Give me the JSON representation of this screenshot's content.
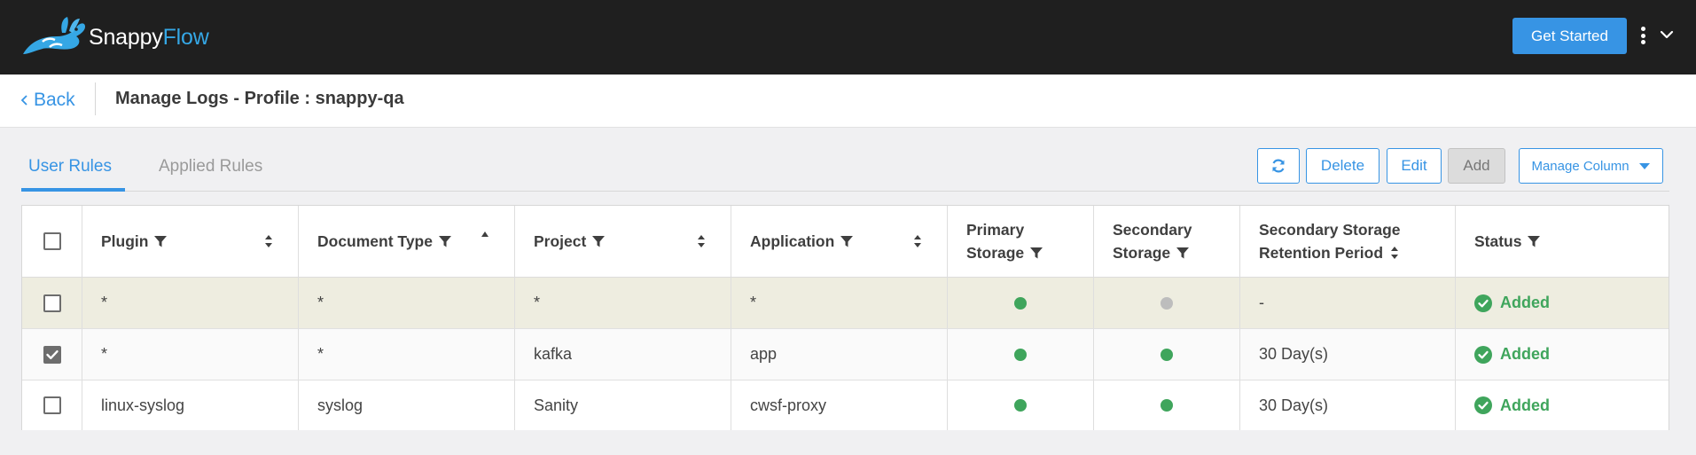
{
  "app": {
    "logo_text_1": "Snappy",
    "logo_text_2": "Flow",
    "get_started_label": "Get Started"
  },
  "header": {
    "back_label": "Back",
    "title": "Manage Logs - Profile : snappy-qa"
  },
  "tabs": [
    {
      "label": "User Rules",
      "active": true
    },
    {
      "label": "Applied Rules",
      "active": false
    }
  ],
  "toolbar": {
    "refresh_icon": "refresh-icon",
    "delete_label": "Delete",
    "edit_label": "Edit",
    "add_label": "Add",
    "manage_column_label": "Manage Column"
  },
  "table": {
    "columns": [
      {
        "label": "Plugin",
        "filter": true,
        "sort": "both"
      },
      {
        "label": "Document Type",
        "filter": true,
        "sort": "asc"
      },
      {
        "label": "Project",
        "filter": true,
        "sort": "both"
      },
      {
        "label": "Application",
        "filter": true,
        "sort": "both"
      },
      {
        "label_line1": "Primary",
        "label_line2": "Storage",
        "filter": true
      },
      {
        "label_line1": "Secondary",
        "label_line2": "Storage",
        "filter": true
      },
      {
        "label_line1": "Secondary Storage",
        "label_line2": "Retention Period",
        "sort": "both"
      },
      {
        "label": "Status",
        "filter": true
      }
    ],
    "rows": [
      {
        "checked": false,
        "plugin": "*",
        "document_type": "*",
        "project": "*",
        "application": "*",
        "primary_storage": "green",
        "secondary_storage": "grey",
        "retention": "-",
        "status": "Added"
      },
      {
        "checked": true,
        "plugin": "*",
        "document_type": "*",
        "project": "kafka",
        "application": "app",
        "primary_storage": "green",
        "secondary_storage": "green",
        "retention": "30 Day(s)",
        "status": "Added"
      },
      {
        "checked": false,
        "plugin": "linux-syslog",
        "document_type": "syslog",
        "project": "Sanity",
        "application": "cwsf-proxy",
        "primary_storage": "green",
        "secondary_storage": "green",
        "retention": "30 Day(s)",
        "status": "Added"
      }
    ]
  },
  "colors": {
    "accent": "#3794e4",
    "topbar": "#1f1f1f",
    "status_green": "#3fa55c",
    "dot_grey": "#bdbdbd",
    "highlight_row": "#eeede0"
  }
}
